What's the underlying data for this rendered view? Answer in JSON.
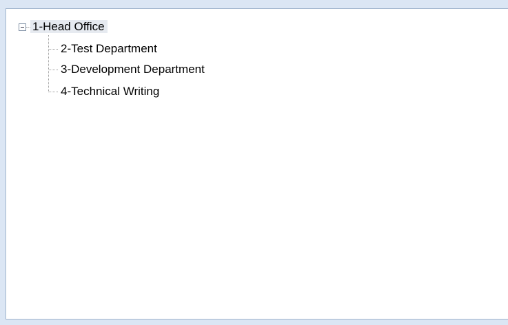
{
  "tree": {
    "root": {
      "label": "1-Head Office",
      "expanded": true
    },
    "children": [
      {
        "label": "2-Test Department"
      },
      {
        "label": "3-Development Department"
      },
      {
        "label": "4-Technical Writing"
      }
    ]
  }
}
